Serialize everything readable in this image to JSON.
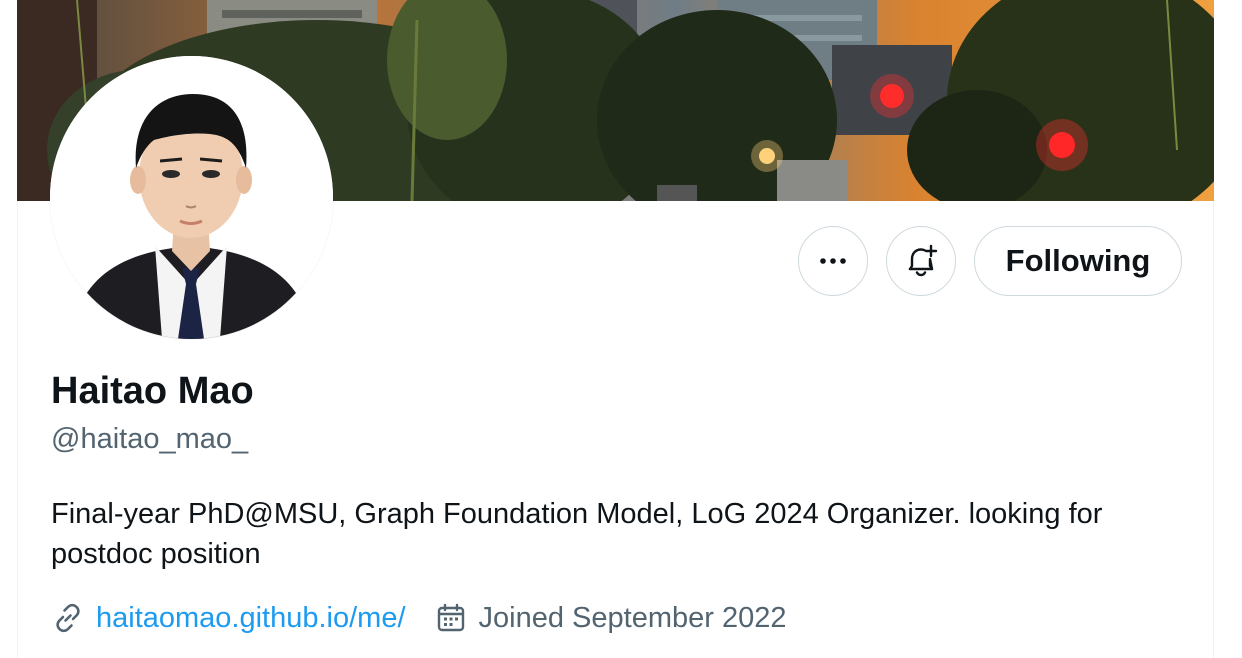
{
  "profile": {
    "display_name": "Haitao Mao",
    "handle": "@haitao_mao_",
    "bio": "Final-year PhD@MSU, Graph Foundation Model, LoG 2024 Organizer. looking for postdoc position",
    "website": "haitaomao.github.io/me/",
    "joined": "Joined September 2022"
  },
  "actions": {
    "more_icon": "more-dots-icon",
    "notify_icon": "bell-plus-icon",
    "following_label": "Following"
  },
  "meta_icons": {
    "link": "link-icon",
    "calendar": "calendar-icon"
  },
  "colors": {
    "text": "#0f1419",
    "secondary": "#536471",
    "link": "#1d9bf0",
    "border": "#cfd9de"
  }
}
